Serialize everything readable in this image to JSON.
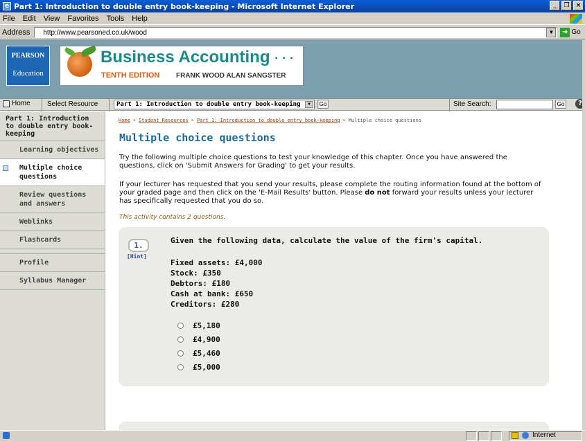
{
  "window": {
    "title": "Part 1: Introduction to double entry book-keeping - Microsoft Internet Explorer"
  },
  "menu": [
    "File",
    "Edit",
    "View",
    "Favorites",
    "Tools",
    "Help"
  ],
  "address": {
    "label": "Address",
    "url": "http://www.pearsoned.co.uk/wood",
    "go": "Go"
  },
  "banner": {
    "publisher_line1": "PEARSON",
    "publisher_line2": "Education",
    "book_title": "Business Accounting",
    "book_title_dots": "· · ·",
    "edition": "TENTH EDITION",
    "authors": "FRANK WOOD   ALAN SANGSTER"
  },
  "nav": {
    "home": "Home",
    "select_resource": "Select Resource",
    "part_select": "Part 1: Introduction to double entry book-keeping",
    "go": "Go",
    "site_search": "Site Search:",
    "go2": "Go",
    "help": "?"
  },
  "sidebar": {
    "section": "Part 1: Introduction to double entry book-keeping",
    "items": [
      {
        "label": "Learning objectives",
        "active": false
      },
      {
        "label": "Multiple choice questions",
        "active": true
      },
      {
        "label": "Review questions and answers",
        "active": false
      },
      {
        "label": "Weblinks",
        "active": false
      },
      {
        "label": "Flashcards",
        "active": false
      },
      {
        "label": "Profile",
        "active": false
      },
      {
        "label": "Syllabus Manager",
        "active": false
      }
    ]
  },
  "breadcrumb": [
    "Home",
    "Student Resources",
    "Part 1: Introduction to double entry book-keeping",
    "Multiple choice questions"
  ],
  "main": {
    "title": "Multiple choice questions",
    "p1": "Try the following multiple choice questions to test your knowledge of this chapter. Once you have answered the questions, click on 'Submit Answers for Grading' to get your results.",
    "p2_a": "If your lecturer has requested that you send your results, please complete the routing information found at the bottom of your graded page and then click on the 'E-Mail Results' button. Please ",
    "p2_b": "do not",
    "p2_c": " forward your results unless your lecturer has specifically requested that you do so.",
    "activity": "This activity contains 2 questions."
  },
  "question": {
    "number": "1.",
    "hint": "[Hint]",
    "text": "Given the following data, calculate the value of the firm's capital.",
    "data": [
      "Fixed assets: £4,000",
      "Stock: £350",
      "Debtors: £180",
      "Cash at bank: £650",
      "Creditors: £280"
    ],
    "options": [
      "£5,180",
      "£4,900",
      "£5,460",
      "£5,000"
    ]
  },
  "status": {
    "zone": "Internet"
  }
}
